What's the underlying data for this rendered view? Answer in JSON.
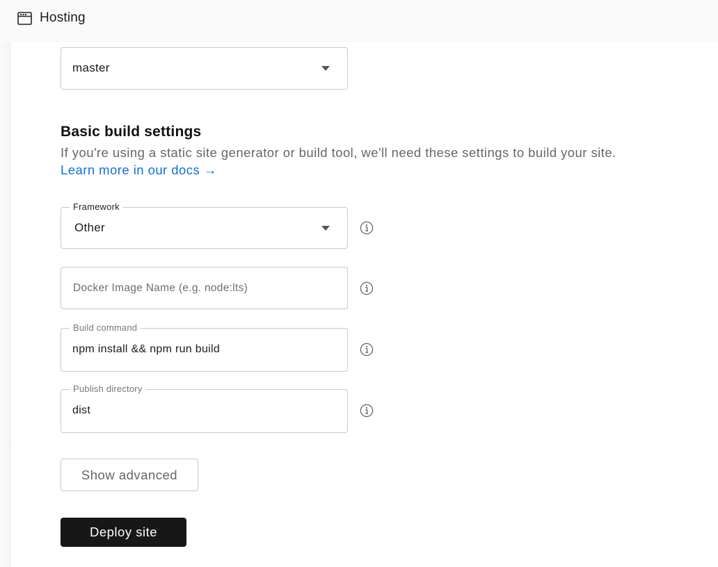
{
  "topbar": {
    "icon": "browser-window-icon",
    "title": "Hosting"
  },
  "branch_select": {
    "value": "master",
    "icon": "chevron-down-icon"
  },
  "build_settings": {
    "heading": "Basic build settings",
    "description": "If you're using a static site generator or build tool, we'll need these settings to build your site.",
    "docs_link": "Learn more in our docs →"
  },
  "fields": {
    "framework": {
      "label": "Framework",
      "value": "Other",
      "info_icon": "info-icon"
    },
    "docker_image": {
      "placeholder": "Docker Image Name (e.g. node:lts)",
      "value": "",
      "info_icon": "info-icon"
    },
    "build_command": {
      "label": "Build command",
      "value": "npm install && npm run build",
      "info_icon": "info-icon"
    },
    "publish_directory": {
      "label": "Publish directory",
      "value": "dist",
      "info_icon": "info-icon"
    }
  },
  "buttons": {
    "show_advanced": "Show advanced",
    "deploy_site": "Deploy site"
  },
  "colors": {
    "link": "#1070e0",
    "primary_button": "#171717",
    "border": "#c8c8c8"
  }
}
